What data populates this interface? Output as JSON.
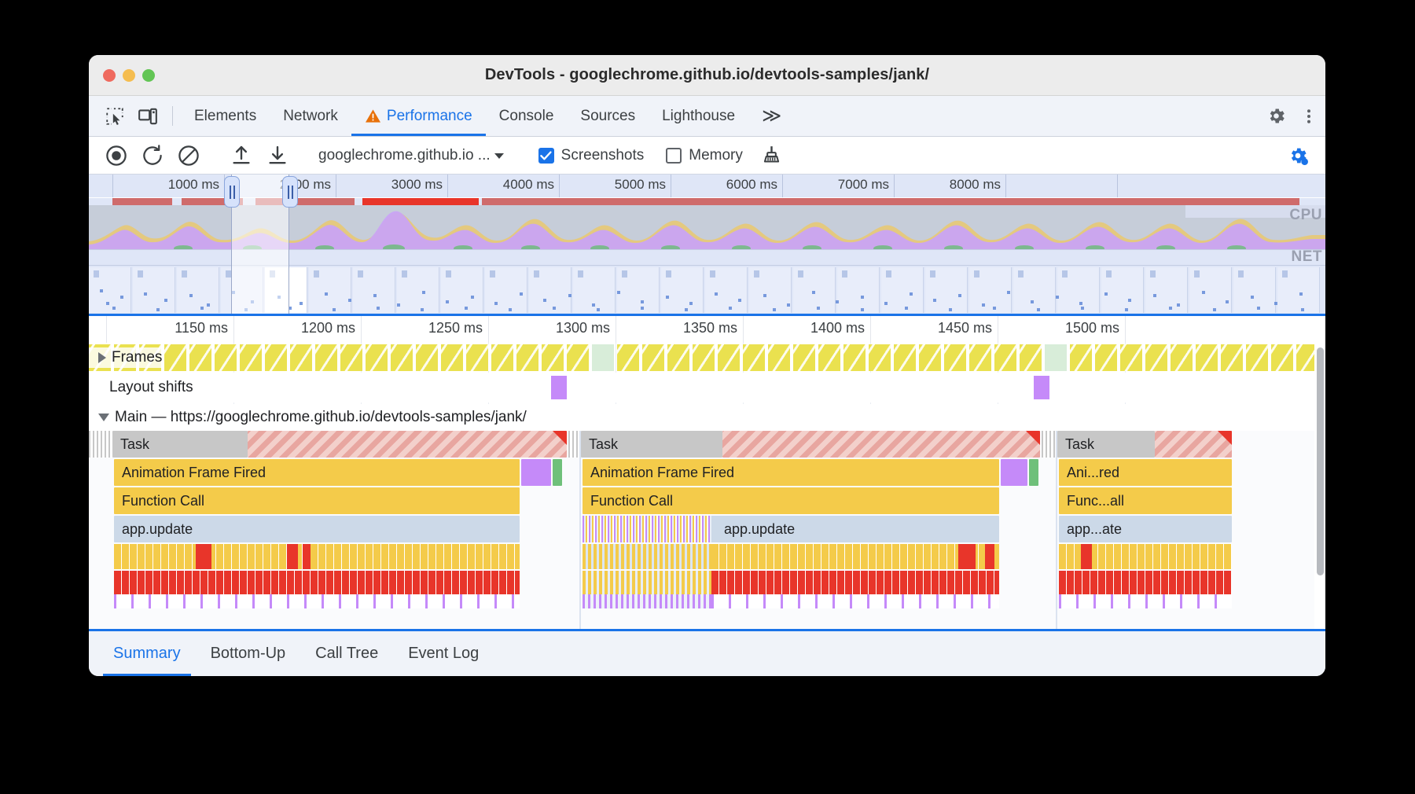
{
  "window": {
    "title": "DevTools - googlechrome.github.io/devtools-samples/jank/",
    "traffic": {
      "close": "close-button",
      "minimize": "minimize-button",
      "zoom": "zoom-button"
    }
  },
  "devtools_tabbar": {
    "icons": [
      "inspect-element-icon",
      "device-toolbar-icon"
    ],
    "tabs": [
      {
        "label": "Elements",
        "active": false,
        "warning": false
      },
      {
        "label": "Network",
        "active": false,
        "warning": false
      },
      {
        "label": "Performance",
        "active": true,
        "warning": true
      },
      {
        "label": "Console",
        "active": false,
        "warning": false
      },
      {
        "label": "Sources",
        "active": false,
        "warning": false
      },
      {
        "label": "Lighthouse",
        "active": false,
        "warning": false
      }
    ],
    "more_tabs": "≫",
    "settings_icon": "gear-icon",
    "menu_icon": "more-vertical-icon"
  },
  "perf_toolbar": {
    "record_icon": "record-icon",
    "reload_icon": "reload-and-record-icon",
    "clear_icon": "clear-recording-icon",
    "upload_icon": "load-profile-icon",
    "download_icon": "save-profile-icon",
    "url_select": "googlechrome.github.io ...",
    "screenshots": {
      "label": "Screenshots",
      "checked": true
    },
    "memory": {
      "label": "Memory",
      "checked": false
    },
    "gc_icon": "collect-garbage-icon",
    "capture_settings_icon": "capture-settings-gear-icon"
  },
  "overview": {
    "ticks": [
      "1000 ms",
      "2000 ms",
      "3000 ms",
      "4000 ms",
      "5000 ms",
      "6000 ms",
      "7000 ms",
      "8000 ms"
    ],
    "cpu_label": "CPU",
    "net_label": "NET",
    "selection": {
      "start_label": "",
      "end_label": ""
    }
  },
  "flame": {
    "ticks": [
      "1150 ms",
      "1200 ms",
      "1250 ms",
      "1300 ms",
      "1350 ms",
      "1400 ms",
      "1450 ms",
      "1500 ms"
    ],
    "tracks": [
      {
        "name": "Frames",
        "label": "Frames",
        "expanded": false
      },
      {
        "name": "Layout shifts",
        "label": "Layout shifts",
        "expanded": null
      },
      {
        "name": "Main",
        "label": "Main — https://googlechrome.github.io/devtools-samples/jank/",
        "expanded": true
      }
    ],
    "events": [
      {
        "label": "Task",
        "group": 1,
        "depth": 0
      },
      {
        "label": "Animation Frame Fired",
        "group": 1,
        "depth": 1
      },
      {
        "label": "Function Call",
        "group": 1,
        "depth": 2
      },
      {
        "label": "app.update",
        "group": 1,
        "depth": 3
      },
      {
        "label": "Task",
        "group": 2,
        "depth": 0
      },
      {
        "label": "Animation Frame Fired",
        "group": 2,
        "depth": 1
      },
      {
        "label": "Function Call",
        "group": 2,
        "depth": 2
      },
      {
        "label": "app.update",
        "group": 2,
        "depth": 3
      },
      {
        "label": "Task",
        "group": 3,
        "depth": 0
      },
      {
        "label": "Ani...red",
        "group": 3,
        "depth": 1
      },
      {
        "label": "Func...all",
        "group": 3,
        "depth": 2
      },
      {
        "label": "app...ate",
        "group": 3,
        "depth": 3
      }
    ]
  },
  "bottom_tabs": [
    {
      "label": "Summary",
      "active": true
    },
    {
      "label": "Bottom-Up",
      "active": false
    },
    {
      "label": "Call Tree",
      "active": false
    },
    {
      "label": "Event Log",
      "active": false
    }
  ],
  "colors": {
    "accent": "#1a73e8",
    "warning": "#e8710a",
    "frame_yellow": "#eae14f",
    "event_yellow": "#f4cb4a",
    "event_blue": "#ccd9e8",
    "event_purple": "#c58af9",
    "event_green": "#6fc07a",
    "event_red": "#e8352a",
    "task_gray": "#c7c7c7",
    "long_task_red": "#e8a6a0"
  }
}
